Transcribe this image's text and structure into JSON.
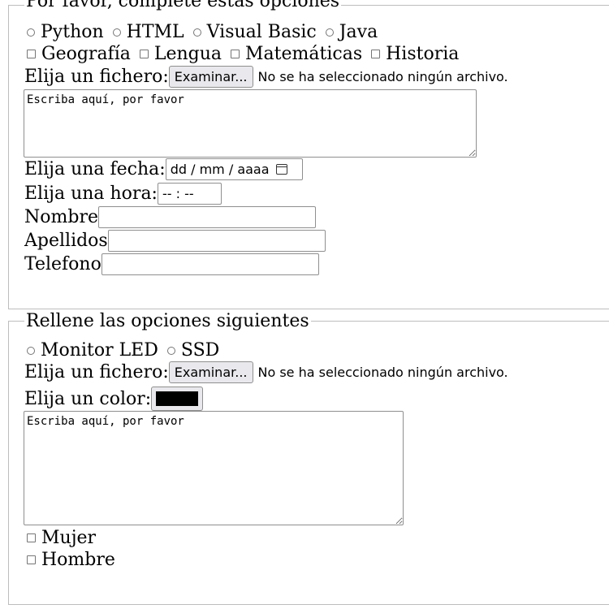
{
  "form1": {
    "legend": "Por favor, complete estas opciones",
    "radios": [
      "Python",
      "HTML",
      "Visual Basic",
      "Java"
    ],
    "checks": [
      "Geografía",
      "Lengua",
      "Matemáticas",
      "Historia"
    ],
    "file_label": "Elija un fichero:",
    "file_button": "Examinar...",
    "file_status": "No se ha seleccionado ningún archivo.",
    "textarea_text": "Escriba aquí, por favor",
    "date_label": "Elija una fecha:",
    "date_placeholder": "dd / mm / aaaa",
    "time_label": "Elija una hora:",
    "time_placeholder": "-- : --",
    "name_label": "Nombre",
    "surname_label": "Apellidos",
    "phone_label": "Telefono"
  },
  "form2": {
    "legend": "Rellene las opciones siguientes",
    "radios": [
      "Monitor LED",
      "SSD"
    ],
    "file_label": "Elija un fichero:",
    "file_button": "Examinar...",
    "file_status": "No se ha seleccionado ningún archivo.",
    "color_label": "Elija un color:",
    "color_value": "#000000",
    "textarea_text": "Escriba aquí, por favor",
    "checks": [
      "Mujer",
      "Hombre"
    ]
  }
}
